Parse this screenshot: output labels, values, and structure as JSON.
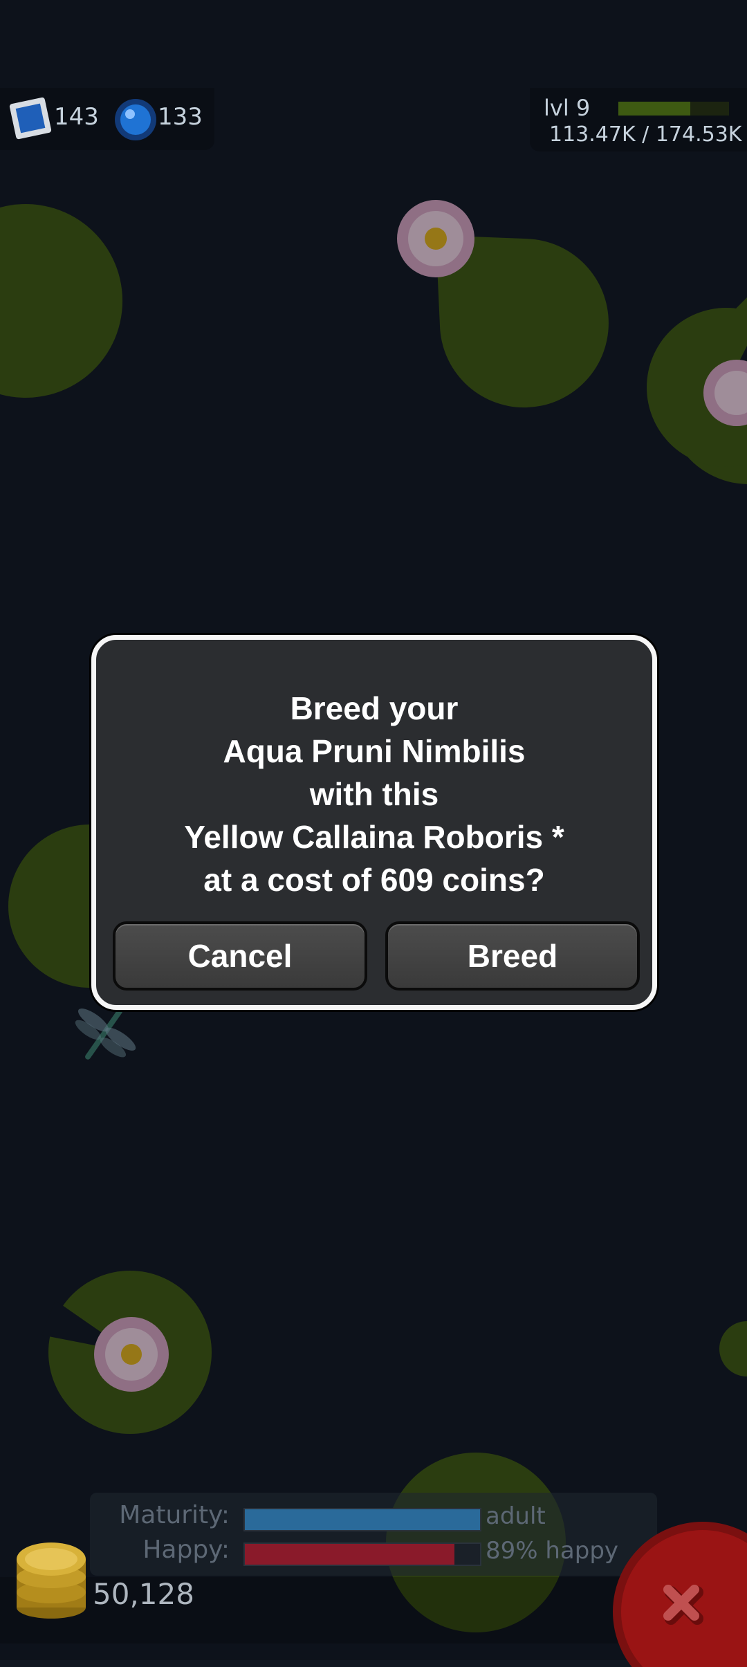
{
  "hud": {
    "stamps": "143",
    "orbs": "133",
    "level": "lvl 9",
    "xp_text": "113.47K / 174.53K",
    "xp_fraction": 0.65
  },
  "dialog": {
    "lines": [
      "Breed your",
      "Aqua Pruni Nimbilis",
      "with this",
      "Yellow Callaina Roboris *",
      "at a cost of 609 coins?"
    ],
    "cancel_label": "Cancel",
    "breed_label": "Breed"
  },
  "status": {
    "maturity_label": "Maturity:",
    "maturity_value": "adult",
    "maturity_fraction": 1.0,
    "happy_label": "Happy:",
    "happy_value": "89% happy",
    "happy_fraction": 0.89,
    "coins": "50,128"
  },
  "colors": {
    "pond": "#121822",
    "lilypad": "#3f5a12",
    "maturity_bar": "#2a6a9a",
    "happy_bar": "#8a1a2a",
    "close_button": "#9a1414"
  },
  "icons": [
    "stamp-icon",
    "orb-icon",
    "coins-icon",
    "close-icon",
    "water-lily-icon",
    "dragonfly-icon"
  ]
}
